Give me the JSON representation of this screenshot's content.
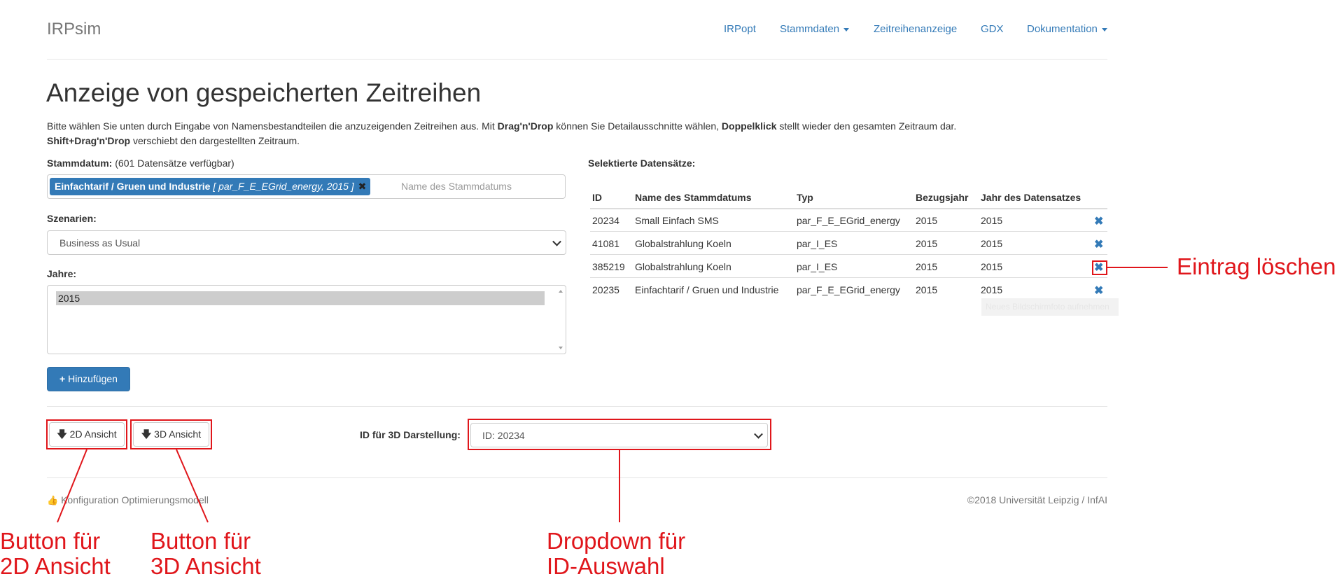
{
  "navbar": {
    "brand": "IRPsim",
    "links": [
      "IRPopt",
      "Stammdaten",
      "Zeitreihenanzeige",
      "GDX",
      "Dokumentation"
    ]
  },
  "page": {
    "title": "Anzeige von gespeicherten Zeitreihen",
    "intro": {
      "p1": "Bitte wählen Sie unten durch Eingabe von Namensbestandteilen die anzuzeigenden Zeitreihen aus. Mit ",
      "b1": "Drag'n'Drop",
      "p2": " können Sie Detailausschnitte wählen, ",
      "b2": "Doppelklick",
      "p3": " stellt wieder den gesamten Zeitraum dar.",
      "b3": "Shift+Drag'n'Drop",
      "p4": " verschiebt den dargestellten Zeitraum."
    }
  },
  "form": {
    "stammdatum_label": "Stammdatum:",
    "stammdatum_count": " (601 Datensätze verfügbar)",
    "token_label": "Einfachtarif / Gruen und Industrie",
    "token_meta": "[ par_F_E_EGrid_energy, 2015 ]",
    "token_remove": "✖",
    "stammdatum_placeholder": "Name des Stammdatums",
    "szenarien_label": "Szenarien:",
    "szenarien_value": "Business as Usual",
    "jahre_label": "Jahre:",
    "jahre_items": [
      "2015"
    ],
    "add_button": "Hinzufügen",
    "add_icon": "+"
  },
  "selected": {
    "title": "Selektierte Datensätze:",
    "columns": [
      "ID",
      "Name des Stammdatums",
      "Typ",
      "Bezugsjahr",
      "Jahr des Datensatzes"
    ],
    "rows": [
      {
        "id": "20234",
        "name": "Small Einfach SMS",
        "typ": "par_F_E_EGrid_energy",
        "bezugsjahr": "2015",
        "jahr": "2015"
      },
      {
        "id": "41081",
        "name": "Globalstrahlung Koeln",
        "typ": "par_I_ES",
        "bezugsjahr": "2015",
        "jahr": "2015"
      },
      {
        "id": "385219",
        "name": "Globalstrahlung Koeln",
        "typ": "par_I_ES",
        "bezugsjahr": "2015",
        "jahr": "2015"
      },
      {
        "id": "20235",
        "name": "Einfachtarif / Gruen und Industrie",
        "typ": "par_F_E_EGrid_energy",
        "bezugsjahr": "2015",
        "jahr": "2015"
      }
    ],
    "delete_icon": "✖",
    "tooltip": "Neues Bildschirmfoto aufnehmen"
  },
  "views": {
    "btn_2d": "2D Ansicht",
    "btn_3d": "3D Ansicht",
    "arrow_icon": "🡇",
    "id_label": "ID für 3D Darstellung:",
    "id_value": "ID: 20234"
  },
  "footer": {
    "left": "Konfiguration Optimierungsmodell",
    "right": "©2018 Universität Leipzig / InfAI"
  },
  "annotations": {
    "delete": "Eintrag löschen",
    "btn2d_line1": "Button für",
    "btn2d_line2": "2D Ansicht",
    "btn3d_line1": "Button für",
    "btn3d_line2": "3D Ansicht",
    "dropdown_line1": "Dropdown für",
    "dropdown_line2": "ID-Auswahl"
  },
  "colors": {
    "primary": "#337ab7",
    "annotation": "#e0161b"
  }
}
